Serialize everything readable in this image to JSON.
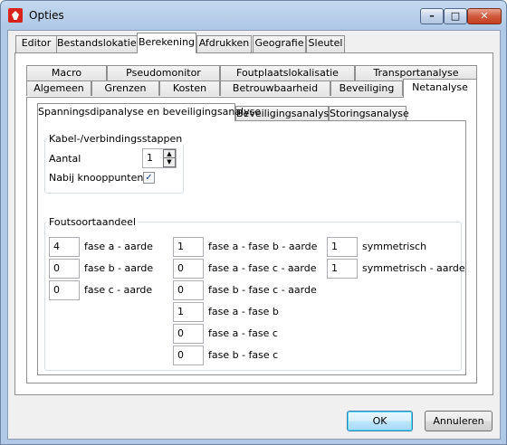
{
  "window": {
    "title": "Opties"
  },
  "main_tabs": [
    "Editor",
    "Bestandslokaties",
    "Berekening",
    "Afdrukken",
    "Geografie",
    "Sleutel"
  ],
  "sub_tabs_row1": [
    "Macro",
    "Pseudomonitor",
    "Foutplaatslokalisatie",
    "Transportanalyse"
  ],
  "sub_tabs_row2": [
    "Algemeen",
    "Grenzen",
    "Kosten",
    "Betrouwbaarheid",
    "Beveiliging",
    "Netanalyse"
  ],
  "inner_tabs": [
    "Spanningsdipanalyse en beveiligingsanalyse",
    "Beveiligingsanalyse",
    "Storingsanalyse"
  ],
  "kabel": {
    "group_title": "Kabel-/verbindingsstappen",
    "aantal_label": "Aantal",
    "aantal_value": "1",
    "nabij_label": "Nabij knooppunten",
    "nabij_checked": true
  },
  "fout": {
    "group_title": "Foutsoortaandeel",
    "col1": [
      {
        "value": "4",
        "label": "fase a - aarde"
      },
      {
        "value": "0",
        "label": "fase b - aarde"
      },
      {
        "value": "0",
        "label": "fase c - aarde"
      }
    ],
    "col2": [
      {
        "value": "1",
        "label": "fase a - fase b - aarde"
      },
      {
        "value": "0",
        "label": "fase a - fase c - aarde"
      },
      {
        "value": "0",
        "label": "fase b - fase c - aarde"
      },
      {
        "value": "1",
        "label": "fase a - fase b"
      },
      {
        "value": "0",
        "label": "fase a - fase c"
      },
      {
        "value": "0",
        "label": "fase b - fase c"
      }
    ],
    "col3": [
      {
        "value": "1",
        "label": "symmetrisch"
      },
      {
        "value": "1",
        "label": "symmetrisch - aarde"
      }
    ]
  },
  "buttons": {
    "ok": "OK",
    "cancel": "Annuleren"
  }
}
